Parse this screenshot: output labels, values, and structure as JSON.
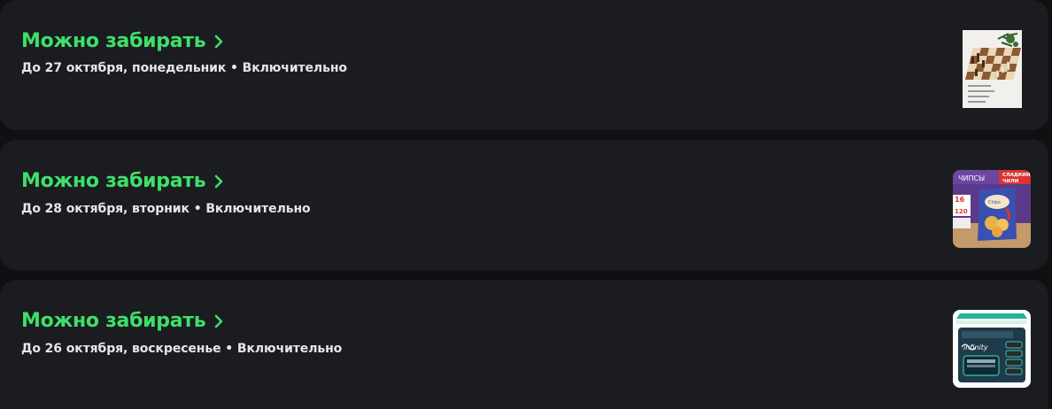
{
  "orders": [
    {
      "status": "Можно забирать",
      "pickup_until": "До 27 октября, понедельник • Включительно",
      "product_icon": "chess-set-icon"
    },
    {
      "status": "Можно забирать",
      "pickup_until": "До 28 октября, вторник • Включительно",
      "product_icon": "chips-pack-icon",
      "thumb_texts": {
        "top_left": "ЧИПСЫ",
        "top_right": "СЛАДКИЙ ЧИЛИ",
        "badge_count": "16",
        "badge_weight": "120"
      }
    },
    {
      "status": "Можно забирать",
      "pickup_until": "До 26 октября, воскресенье • Включительно",
      "product_icon": "razor-cartridges-icon",
      "thumb_texts": {
        "brand": "infinity"
      }
    }
  ],
  "colors": {
    "background": "#0f1012",
    "card": "#1a1c1f",
    "status_green": "#3ee06a",
    "subtitle": "#e4e6ea"
  }
}
